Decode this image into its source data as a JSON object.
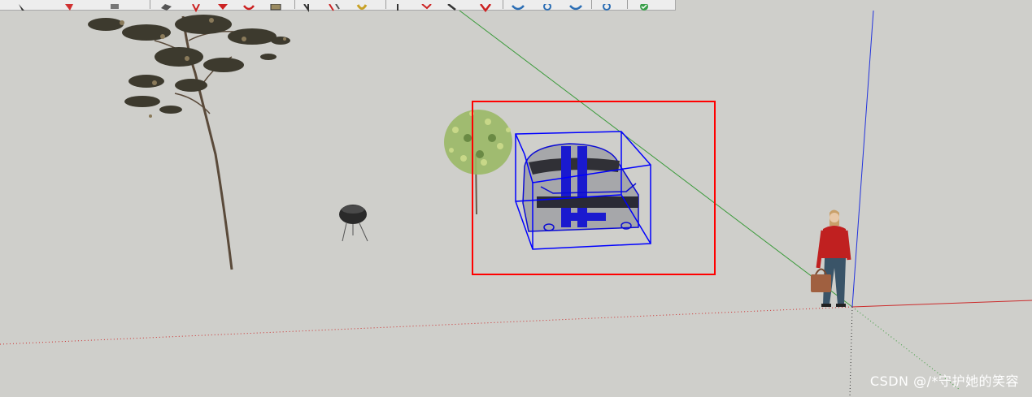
{
  "toolbar": {
    "tools": [
      {
        "name": "select-tool",
        "icon": "arrow-cursor-icon",
        "color": "#333333"
      },
      {
        "name": "eraser-tool",
        "icon": "eraser-icon",
        "color": "#d03030"
      },
      {
        "name": "paint-bucket-tool",
        "icon": "paint-bucket-icon",
        "color": "#555555"
      },
      {
        "name": "push-pull-tool",
        "icon": "push-pull-icon",
        "color": "#444444"
      },
      {
        "name": "move-tool",
        "icon": "move-icon",
        "color": "#cc2222"
      },
      {
        "name": "rotate-tool",
        "icon": "rotate-icon",
        "color": "#cc2222"
      },
      {
        "name": "follow-me-tool",
        "icon": "follow-me-icon",
        "color": "#cc2222"
      },
      {
        "name": "offset-tool",
        "icon": "offset-icon",
        "color": "#8a7a55"
      },
      {
        "name": "tape-measure-tool",
        "icon": "tape-measure-icon",
        "color": "#444444"
      },
      {
        "name": "dimension-tool",
        "icon": "dimension-icon",
        "color": "#cc2222"
      },
      {
        "name": "protractor-tool",
        "icon": "protractor-icon",
        "color": "#c9a227"
      },
      {
        "name": "text-tool",
        "icon": "text-icon",
        "color": "#444444"
      },
      {
        "name": "axes-tool",
        "icon": "axes-icon",
        "color": "#cc2222"
      },
      {
        "name": "3d-text-tool",
        "icon": "3d-text-icon",
        "color": "#444444"
      },
      {
        "name": "section-plane-tool",
        "icon": "section-plane-icon",
        "color": "#cc2222"
      },
      {
        "name": "orbit-tool",
        "icon": "orbit-icon",
        "color": "#2d6fb5"
      },
      {
        "name": "pan-tool",
        "icon": "pan-icon",
        "color": "#2d6fb5"
      },
      {
        "name": "zoom-tool",
        "icon": "zoom-icon",
        "color": "#2d6fb5"
      },
      {
        "name": "warehouse-tool",
        "icon": "warehouse-icon",
        "color": "#2d6fb5"
      },
      {
        "name": "extension-tool",
        "icon": "extension-icon",
        "color": "#3aa04a"
      }
    ]
  },
  "scene": {
    "axis_colors": {
      "red": "#cc2b2b",
      "green": "#3a9a3a",
      "blue": "#2233dd"
    },
    "selection_color": "#0000ff",
    "highlight_color": "#ff0000",
    "models": [
      "tree",
      "grill",
      "shrub",
      "car",
      "person"
    ]
  },
  "watermark": "CSDN @/*守护她的笑容"
}
